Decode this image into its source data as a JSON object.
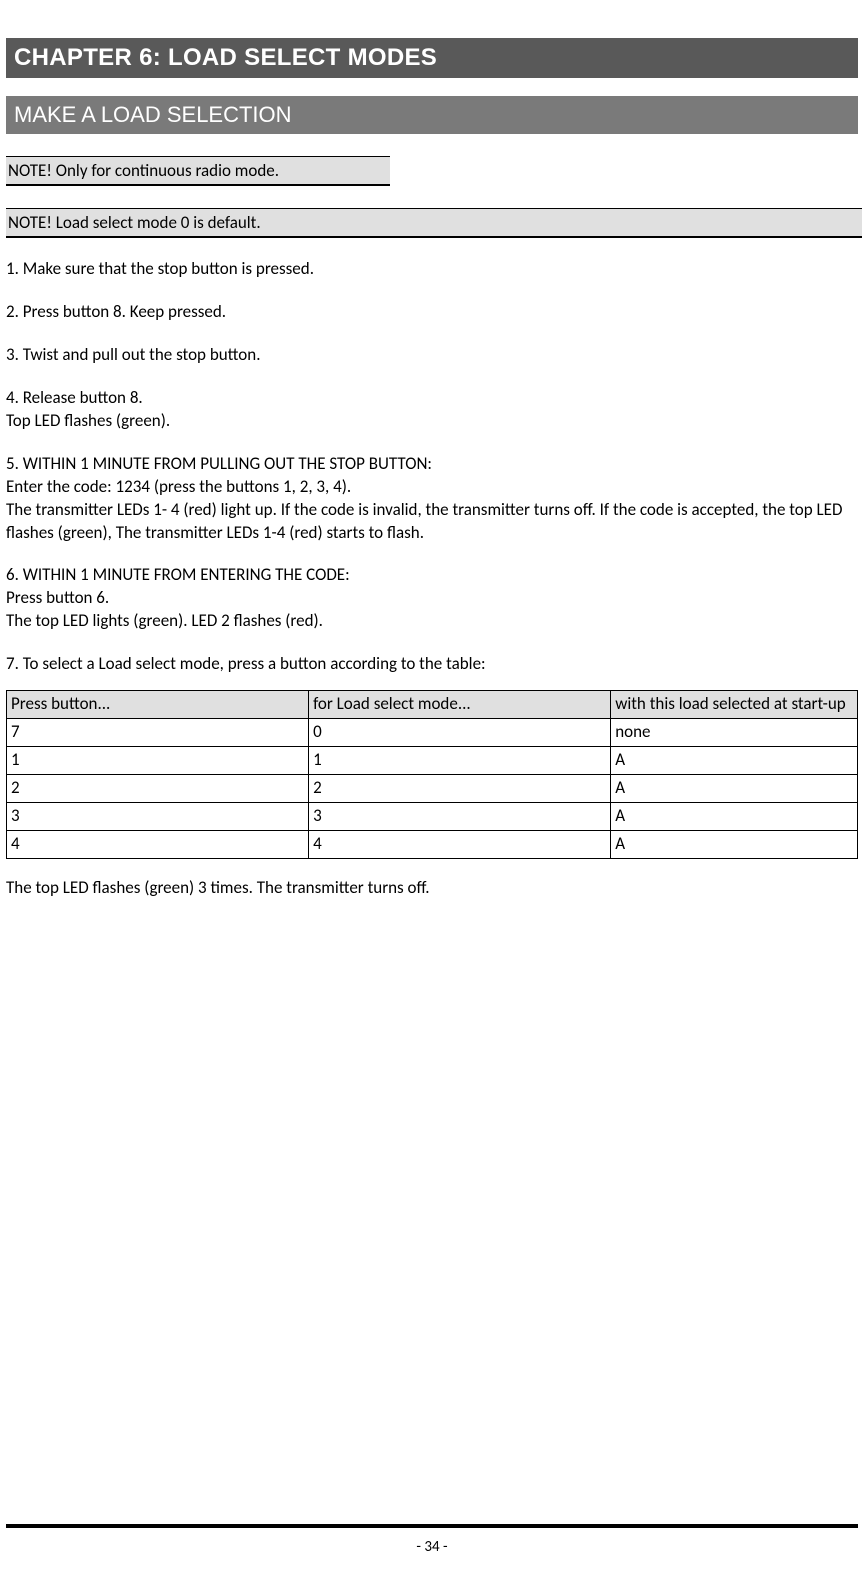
{
  "chapter_title": "CHAPTER 6: LOAD SELECT MODES",
  "section_title": "MAKE A LOAD SELECTION",
  "notes": [
    "NOTE! Only for continuous radio mode.",
    "NOTE! Load select mode 0 is default."
  ],
  "steps": {
    "s1": "1. Make sure that the stop button is pressed.",
    "s2": "2. Press button 8. Keep pressed.",
    "s3": "3. Twist and pull out the stop button.",
    "s4a": "4. Release button 8.",
    "s4b": "Top LED flashes (green).",
    "s5a": "5. WITHIN 1 MINUTE FROM PULLING OUT THE STOP BUTTON:",
    "s5b": "Enter the code: 1234 (press the buttons 1, 2, 3, 4).",
    "s5c": "The transmitter LEDs 1- 4 (red) light up. If the code is invalid, the transmitter turns off. If the code is accepted, the top LED flashes (green), The transmitter LEDs 1-4 (red) starts to flash.",
    "s6a": "6. WITHIN 1 MINUTE FROM ENTERING THE CODE:",
    "s6b": "Press button 6.",
    "s6c": "The top LED lights (green). LED 2 flashes (red).",
    "s7": "7. To select a Load select mode, press a button according to the table:"
  },
  "table": {
    "headers": [
      "Press button...",
      "for Load select mode...",
      "with this load selected at start-up"
    ],
    "rows": [
      [
        "7",
        "0",
        "none"
      ],
      [
        "1",
        "1",
        "A"
      ],
      [
        "2",
        "2",
        "A"
      ],
      [
        "3",
        "3",
        "A"
      ],
      [
        "4",
        "4",
        "A"
      ]
    ]
  },
  "after_table": "The top LED flashes (green) 3 times. The transmitter turns off.",
  "page_number": "- 34 -"
}
